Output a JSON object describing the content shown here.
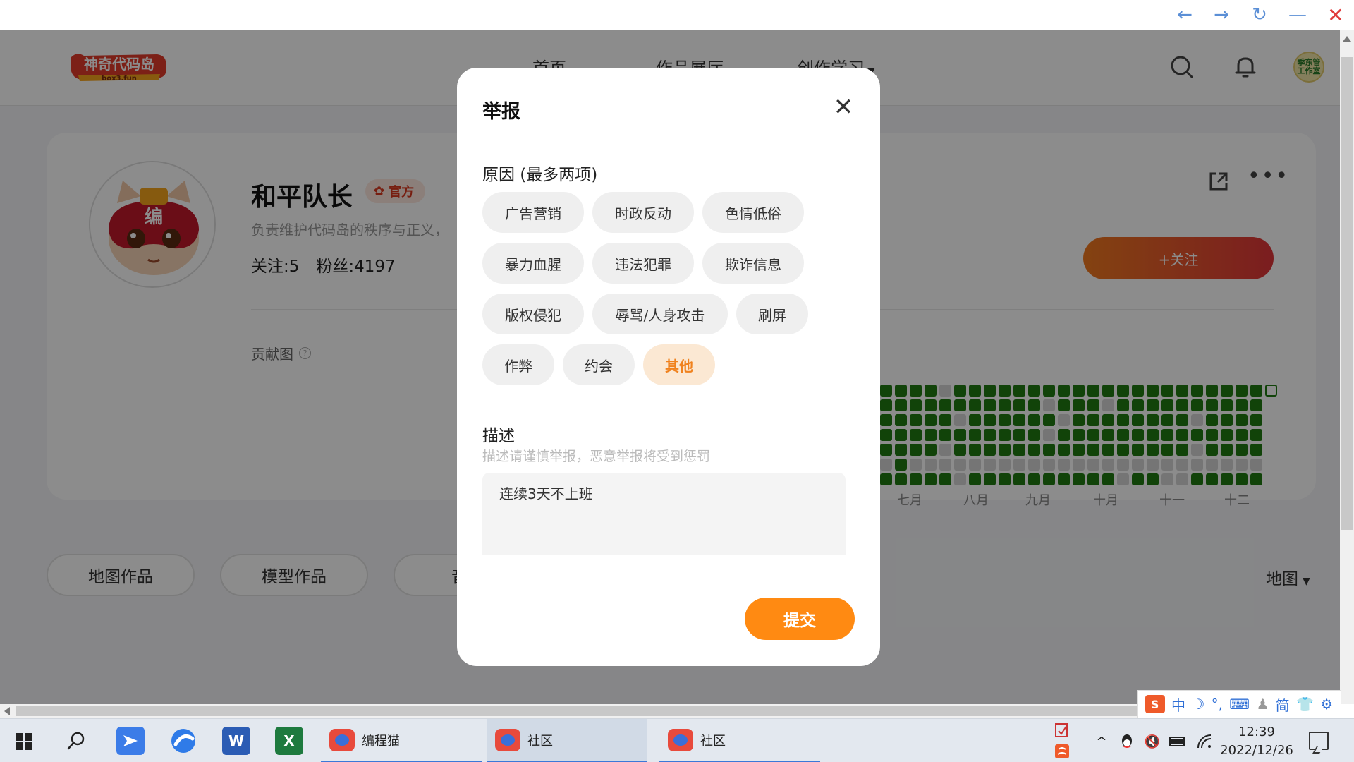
{
  "window": {
    "back": "←",
    "forward": "→",
    "refresh": "↻",
    "minimize": "—",
    "close": "✕"
  },
  "header": {
    "logo_text": "神奇代码岛",
    "logo_sub": "box3.fun",
    "nav": [
      "首页",
      "作品展厅",
      "创作学习"
    ],
    "avatar_text": "季东管\n工作室"
  },
  "profile": {
    "name": "和平队长",
    "badge": "官方",
    "bio": "负责维护代码岛的秩序与正义，",
    "following": "关注:5",
    "followers": "粉丝:4197",
    "follow_button": "+关注",
    "contrib_label": "贡献图",
    "help": "?",
    "months": [
      "七月",
      "八月",
      "九月",
      "十月",
      "十一",
      "十二"
    ],
    "heatmap": [
      "11110111111111111111111111",
      "11111111111011101111111111",
      "11111011111101111111101111",
      "11111111111011111111111111",
      "11110111111111111111101111",
      "01000000000000000000000000",
      "11111011111111110110011111"
    ],
    "colors": {
      "active": "#1f7a12",
      "empty": "#d6d6d6",
      "accent": "#f0821e"
    }
  },
  "tabs": [
    "地图作品",
    "模型作品",
    "音乐"
  ],
  "sort_select": "地图",
  "dialog": {
    "title": "举报",
    "close": "✕",
    "reason_label": "原因 (最多两项)",
    "reasons": [
      "广告营销",
      "时政反动",
      "色情低俗",
      "暴力血腥",
      "违法犯罪",
      "欺诈信息",
      "版权侵犯",
      "辱骂/人身攻击",
      "刷屏",
      "作弊",
      "约会",
      "其他"
    ],
    "selected_reason": "其他",
    "desc_label": "描述",
    "desc_hint": "描述请谨慎举报，恶意举报将受到惩罚",
    "desc_value": "连续3天不上班",
    "submit": "提交"
  },
  "ime": {
    "mode": "中",
    "moon": "☽",
    "dots": "°,",
    "keyboard": "⌨",
    "person": "♟",
    "simplified": "简",
    "shirt": "👕",
    "gear": "⚙"
  },
  "taskbar": {
    "word": "W",
    "excel": "X",
    "tasks": [
      "编程猫",
      "社区",
      "社区"
    ],
    "tray": {
      "chevron": "^",
      "mute": "🔇",
      "battery": "▭",
      "wifi": "((·"
    },
    "time": "12:39",
    "date": "2022/12/26"
  }
}
